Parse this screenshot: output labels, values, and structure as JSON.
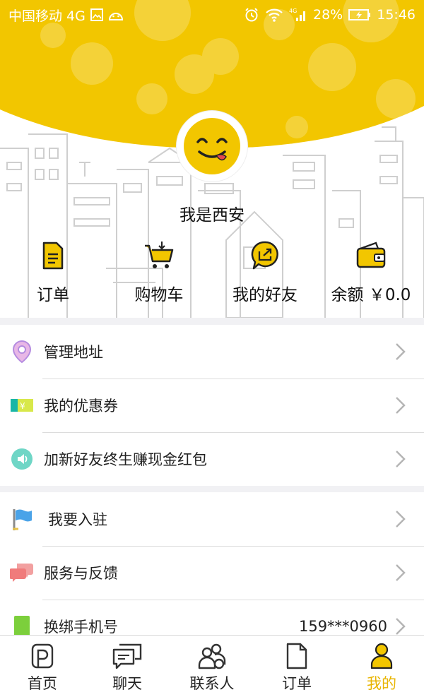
{
  "status_bar": {
    "carrier": "中国移动 4G",
    "battery": "28%",
    "time": "15:46"
  },
  "profile": {
    "username": "我是西安"
  },
  "quick_actions": [
    {
      "label": "订单",
      "icon": "order-icon"
    },
    {
      "label": "购物车",
      "icon": "cart-icon"
    },
    {
      "label": "我的好友",
      "icon": "share-friends-icon"
    },
    {
      "label": "余额 ￥0.0",
      "icon": "wallet-icon"
    }
  ],
  "menu_group_1": [
    {
      "label": "管理地址",
      "icon": "location-pin-icon"
    },
    {
      "label": "我的优惠券",
      "icon": "coupon-icon"
    },
    {
      "label": "加新好友终生赚现金红包",
      "icon": "speaker-icon"
    }
  ],
  "menu_group_2": [
    {
      "label": "我要入驻",
      "icon": "flag-icon"
    },
    {
      "label": "服务与反馈",
      "icon": "chat-bubbles-icon"
    },
    {
      "label": "换绑手机号",
      "icon": "phone-icon",
      "value": "159***0960"
    }
  ],
  "tabs": [
    {
      "label": "首页",
      "icon": "home-icon",
      "active": false
    },
    {
      "label": "聊天",
      "icon": "chat-icon",
      "active": false
    },
    {
      "label": "联系人",
      "icon": "contacts-icon",
      "active": false
    },
    {
      "label": "订单",
      "icon": "document-icon",
      "active": false
    },
    {
      "label": "我的",
      "icon": "profile-icon",
      "active": true
    }
  ],
  "colors": {
    "accent": "#f2c600",
    "active_tab": "#e8b400",
    "divider_bg": "#f1f1f4"
  }
}
